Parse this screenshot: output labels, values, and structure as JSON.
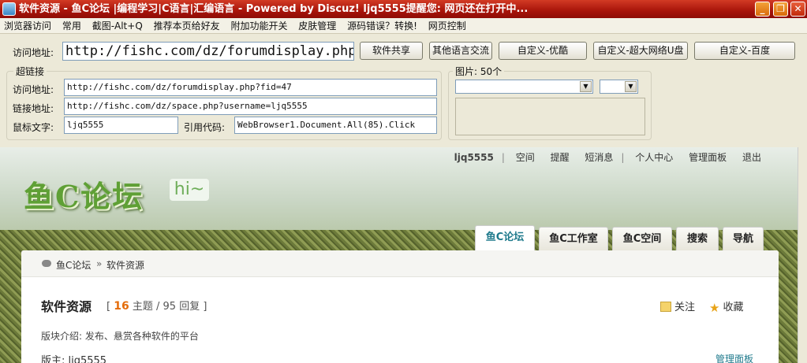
{
  "window": {
    "title": "软件资源 - 鱼C论坛 |编程学习|C语言|汇编语言 - Powered by Discuz!  ljq5555提醒您: 网页还在打开中..."
  },
  "menu": [
    "浏览器访问",
    "常用",
    "截图-Alt+Q",
    "推荐本页给好友",
    "附加功能开关",
    "皮肤管理",
    "源码错误？转换!",
    "网页控制"
  ],
  "address": {
    "label": "访问地址:",
    "value": "http://fishc.com/dz/forumdisplay.php?fid=47"
  },
  "buttons": [
    "软件共享",
    "其他语言交流",
    "自定义-优酷",
    "自定义-超大网络U盘",
    "自定义-百度"
  ],
  "hyperlink_group": {
    "title": "超链接",
    "visit_label": "访问地址:",
    "visit_value": "http://fishc.com/dz/forumdisplay.php?fid=47",
    "link_label": "链接地址:",
    "link_value": "http://fishc.com/dz/space.php?username=ljq5555",
    "mouse_label": "鼠标文字:",
    "mouse_value": "ljq5555",
    "ref_label": "引用代码:",
    "ref_value": "WebBrowser1.Document.All(85).Click"
  },
  "image_group": {
    "title": "图片:",
    "count": "50个"
  },
  "web": {
    "user": "ljq5555",
    "topnav": [
      "空间",
      "提醒",
      "短消息",
      "个人中心",
      "管理面板",
      "退出"
    ],
    "logo": "鱼C论坛",
    "hi": "hi~",
    "tabs": [
      "鱼C论坛",
      "鱼C工作室",
      "鱼C空间",
      "搜索",
      "导航"
    ],
    "breadcrumb_home": "鱼C论坛",
    "breadcrumb_current": "软件资源",
    "forum_title": "软件资源",
    "stats_open": "[",
    "topics": "16",
    "topics_label": "主题",
    "slash": "/",
    "replies": "95",
    "replies_label": "回复",
    "stats_close": "]",
    "follow": "关注",
    "favorite": "收藏",
    "description": "版块介绍: 发布、悬赏各种软件的平台",
    "moderator": "版主: ljq5555",
    "manage": "管理面板"
  },
  "colors": {
    "titlebar": "#b3180c",
    "accent": "#1f7a8c",
    "count": "#e46c0a",
    "logo": "#5fa035"
  }
}
